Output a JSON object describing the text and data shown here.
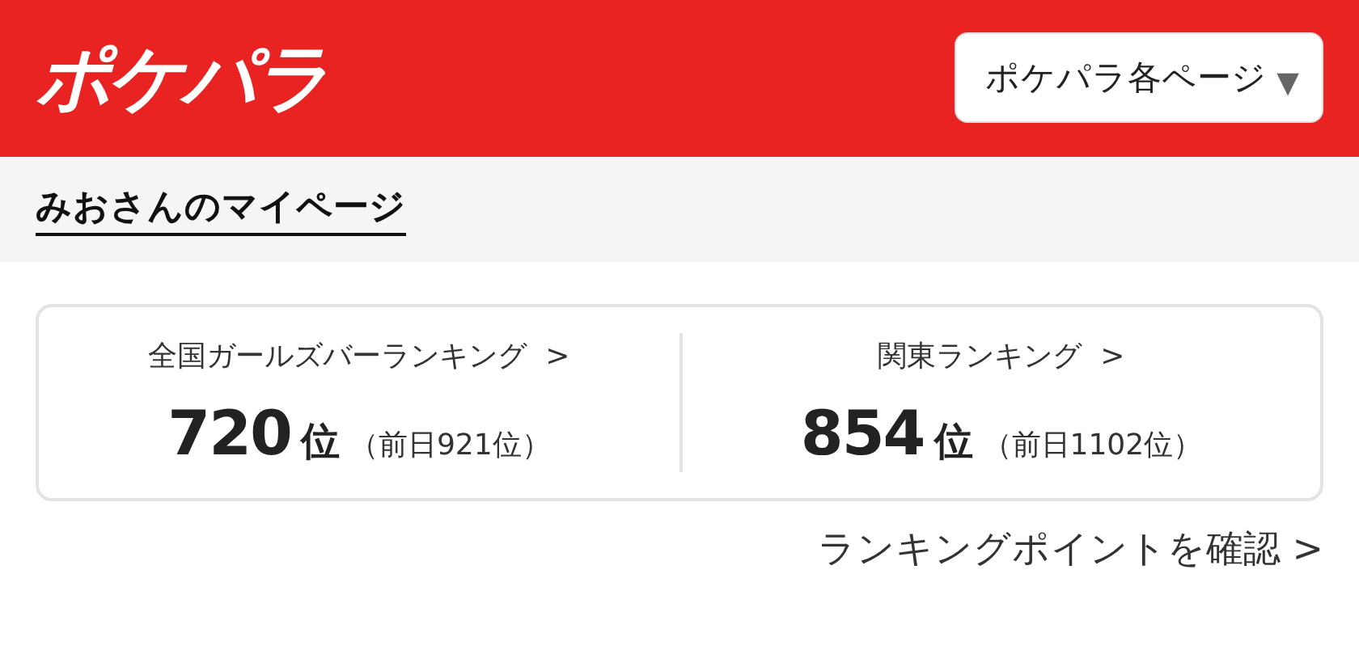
{
  "header": {
    "logo": "ポケパラ",
    "menu_button": {
      "label": "ポケパラ各ページ",
      "caret": "▼"
    }
  },
  "page_title": "みおさんのマイページ",
  "rankings": [
    {
      "title": "全国ガールズバーランキング",
      "arrow": ">",
      "rank": "720",
      "unit": "位",
      "previous": "（前日921位）"
    },
    {
      "title": "関東ランキング",
      "arrow": ">",
      "rank": "854",
      "unit": "位",
      "previous": "（前日1102位）"
    }
  ],
  "points_link": {
    "label": "ランキングポイントを確認",
    "arrow": ">"
  }
}
